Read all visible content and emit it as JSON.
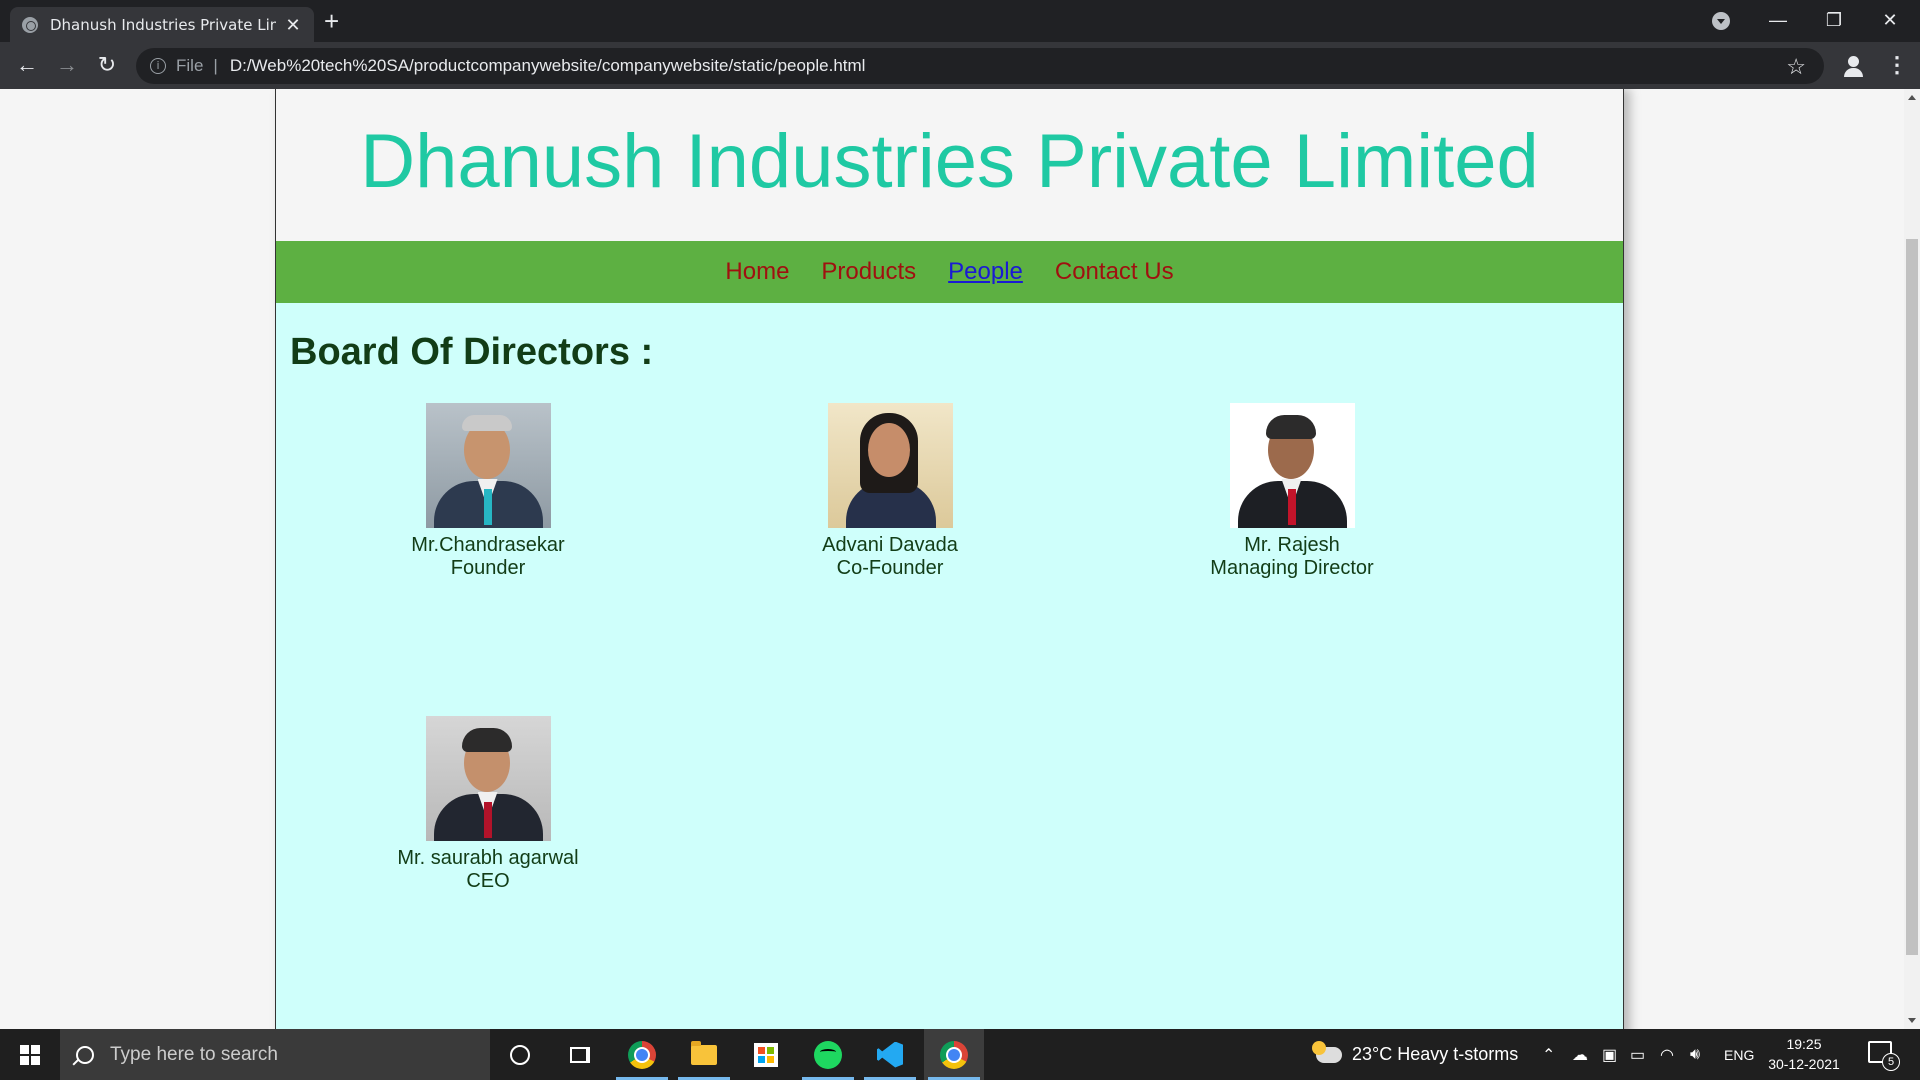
{
  "browser": {
    "tab_title": "Dhanush Industries Private Limite",
    "tab_close": "✕",
    "new_tab": "+",
    "url_scheme_label": "File",
    "url_separator": "|",
    "url": "D:/Web%20tech%20SA/productcompanywebsite/companywebsite/static/people.html",
    "window_controls": {
      "minimize": "—",
      "restore": "❐",
      "close": "✕"
    }
  },
  "site": {
    "title": "Dhanush Industries Private Limited",
    "nav": [
      {
        "label": "Home",
        "active": false
      },
      {
        "label": "Products",
        "active": false
      },
      {
        "label": "People",
        "active": true
      },
      {
        "label": "Contact Us",
        "active": false
      }
    ],
    "section_heading": "Board Of Directors :",
    "people": [
      {
        "name": "Mr.Chandrasekar",
        "role": "Founder",
        "photo": "man-portrait"
      },
      {
        "name": "Advani Davada",
        "role": "Co-Founder",
        "photo": "woman-portrait"
      },
      {
        "name": "Mr. Rajesh",
        "role": "Managing Director",
        "photo": "man-portrait"
      },
      {
        "name": "Mr. saurabh agarwal",
        "role": "CEO",
        "photo": "man-portrait"
      }
    ]
  },
  "taskbar": {
    "search_placeholder": "Type here to search",
    "weather": "23°C  Heavy t-storms",
    "language": "ENG",
    "time": "19:25",
    "date": "30-12-2021",
    "notification_count": "5"
  },
  "colors": {
    "title": "#1fc9a3",
    "nav_bar": "#5db042",
    "nav_link": "#a01010",
    "nav_active": "#1a1ad4",
    "content_bg": "#cffffb",
    "heading": "#123d17"
  }
}
